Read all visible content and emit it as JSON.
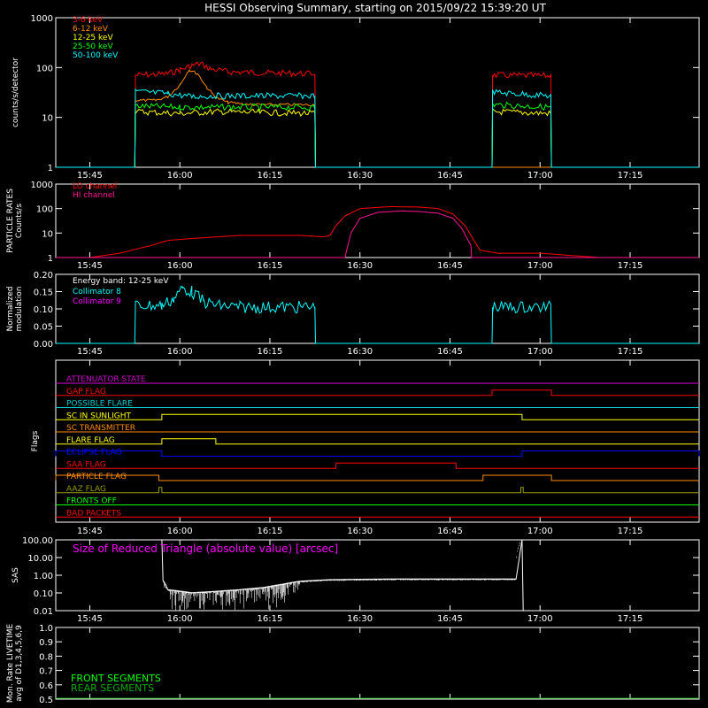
{
  "title": "HESSI Observing Summary, starting on 2015/09/22 15:39:20 UT",
  "time_ticks": [
    "15:45",
    "16:00",
    "16:15",
    "16:30",
    "16:45",
    "17:00",
    "17:15"
  ],
  "time_tick_minutes": [
    45,
    60,
    75,
    90,
    105,
    120,
    135
  ],
  "x_range_minutes": [
    39.33,
    146.5
  ],
  "chart_data": [
    {
      "type": "line",
      "id": "lightcurves",
      "ylabel": "counts/s/detector",
      "yscale": "log",
      "ylim": [
        1,
        1000
      ],
      "yticks": [
        "1",
        "10",
        "100",
        "1000"
      ],
      "yvalues": [
        1,
        10,
        100,
        1000
      ],
      "legend_position": "top-left",
      "series": [
        {
          "name": "3-6 keV",
          "color": "#ff0000",
          "x": [
            39.33,
            52.5,
            52.6,
            58.0,
            60.0,
            62.0,
            63.5,
            65.0,
            68.0,
            75.0,
            82.5,
            82.6,
            112.0,
            112.1,
            121.8,
            121.9,
            146.5
          ],
          "y": [
            1,
            1,
            70,
            75,
            90,
            110,
            120,
            95,
            82,
            78,
            75,
            1,
            1,
            70,
            68,
            1,
            1
          ]
        },
        {
          "name": "6-12 keV",
          "color": "#ff8c00",
          "x": [
            39.33,
            52.5,
            52.6,
            56.0,
            58.0,
            60.0,
            61.5,
            63.0,
            64.5,
            66.0,
            68.0,
            72.0,
            82.5,
            82.6,
            146.5
          ],
          "y": [
            1,
            1,
            22,
            22,
            26,
            45,
            90,
            75,
            40,
            25,
            20,
            18,
            18,
            1,
            1
          ]
        },
        {
          "name": "12-25 keV",
          "color": "#ffff00",
          "x": [
            39.33,
            52.5,
            52.6,
            60.0,
            66.0,
            82.5,
            82.6,
            112.0,
            112.1,
            121.8,
            121.9,
            146.5
          ],
          "y": [
            1,
            1,
            13,
            12,
            13,
            12,
            1,
            1,
            13,
            12,
            1,
            1
          ]
        },
        {
          "name": "25-50 keV",
          "color": "#00ff00",
          "x": [
            39.33,
            52.5,
            52.6,
            60.0,
            82.5,
            82.6,
            112.0,
            112.1,
            121.8,
            121.9,
            146.5
          ],
          "y": [
            1,
            1,
            17,
            16,
            16,
            1,
            1,
            18,
            16,
            1,
            1
          ]
        },
        {
          "name": "50-100 keV",
          "color": "#00ffff",
          "x": [
            39.33,
            52.5,
            52.6,
            58.0,
            62.0,
            66.0,
            82.5,
            82.6,
            112.0,
            112.1,
            121.8,
            121.9,
            146.5
          ],
          "y": [
            1,
            1,
            33,
            30,
            26,
            27,
            27,
            1,
            1,
            32,
            27,
            1,
            1
          ]
        }
      ]
    },
    {
      "type": "line",
      "id": "particle",
      "ylabel": "PARTICLE RATES",
      "ylabel2": "Counts/s",
      "yscale": "log",
      "ylim": [
        1,
        1000
      ],
      "yticks": [
        "1",
        "10",
        "100",
        "1000"
      ],
      "yvalues": [
        1,
        10,
        100,
        1000
      ],
      "legend_position": "top-left",
      "series": [
        {
          "name": "LO channel",
          "color": "#ff0000",
          "x": [
            39.33,
            45.0,
            50.0,
            52.0,
            55.0,
            58.0,
            62.0,
            70.0,
            75.0,
            80.0,
            84.0,
            85.0,
            86.0,
            87.5,
            90.0,
            95.0,
            100.0,
            103.0,
            105.5,
            107.5,
            109.0,
            110.0,
            113.0,
            120.0,
            130.0,
            146.5
          ],
          "y": [
            1,
            1,
            1.5,
            2,
            3,
            5,
            6,
            8,
            8,
            8,
            7,
            8,
            20,
            50,
            100,
            120,
            115,
            100,
            60,
            20,
            5,
            2,
            1.5,
            1.5,
            1,
            1
          ]
        },
        {
          "name": "HI channel",
          "color": "#ff1493",
          "x": [
            39.33,
            87.5,
            88.5,
            90.0,
            93.0,
            97.0,
            100.0,
            103.0,
            105.5,
            107.0,
            108.5,
            108.6,
            146.5
          ],
          "y": [
            1,
            1,
            10,
            40,
            70,
            80,
            75,
            65,
            40,
            15,
            3,
            1,
            1
          ]
        }
      ]
    },
    {
      "type": "line",
      "id": "modulation",
      "ylabel": "Normalized",
      "ylabel2": "modulation",
      "ylim": [
        0.0,
        0.2
      ],
      "yticks": [
        "0.00",
        "0.05",
        "0.10",
        "0.15",
        "0.20"
      ],
      "yvalues": [
        0.0,
        0.05,
        0.1,
        0.15,
        0.2
      ],
      "legend_position": "top-left",
      "legend_header": "Energy band: 12-25 keV",
      "series": [
        {
          "name": "Collimator 8",
          "color": "#00ffff",
          "x": [
            39.33,
            52.5,
            52.6,
            57.0,
            59.0,
            60.5,
            62.0,
            64.0,
            66.0,
            70.0,
            82.5,
            82.6,
            112.0,
            112.1,
            121.8,
            121.9,
            146.5
          ],
          "y": [
            0,
            0,
            0.11,
            0.11,
            0.13,
            0.16,
            0.15,
            0.12,
            0.11,
            0.105,
            0.105,
            0,
            0,
            0.105,
            0.105,
            0,
            0
          ]
        },
        {
          "name": "Collimator 9",
          "color": "#ff00ff",
          "x": [],
          "y": []
        }
      ]
    },
    {
      "type": "line",
      "id": "flags",
      "ylabel": "Flags",
      "flags": [
        {
          "name": "ATTENUATOR STATE",
          "color": "#cc00cc",
          "steps": []
        },
        {
          "name": "GAP FLAG",
          "color": "#ff0000",
          "steps": [
            [
              112.0,
              121.9
            ]
          ]
        },
        {
          "name": "POSSIBLE FLARE",
          "color": "#00cccc",
          "steps": []
        },
        {
          "name": "SC IN SUNLIGHT",
          "color": "#ffff00",
          "steps": [
            [
              57.0,
              117.0
            ]
          ]
        },
        {
          "name": "SC TRANSMITTER",
          "color": "#ff8c00",
          "steps": []
        },
        {
          "name": "FLARE FLAG",
          "color": "#ffff00",
          "steps": [
            [
              57.0,
              66.0
            ]
          ]
        },
        {
          "name": "ECLIPSE FLAG",
          "color": "#0000ff",
          "steps": [
            [
              39.33,
              57.0
            ],
            [
              117.0,
              146.5
            ]
          ]
        },
        {
          "name": "SAA FLAG",
          "color": "#ff0000",
          "steps": [
            [
              86.0,
              106.0
            ]
          ]
        },
        {
          "name": "PARTICLE FLAG",
          "color": "#ff8c00",
          "steps": [
            [
              39.33,
              56.5
            ],
            [
              110.5,
              121.9
            ]
          ]
        },
        {
          "name": "AAZ FLAG",
          "color": "#999900",
          "steps": [
            [
              56.5,
              57.0
            ],
            [
              116.8,
              117.2
            ]
          ]
        },
        {
          "name": "FRONTS OFF",
          "color": "#00ff00",
          "steps": []
        },
        {
          "name": "BAD PACKETS",
          "color": "#ff0000",
          "steps": []
        }
      ]
    },
    {
      "type": "line",
      "id": "sas",
      "ylabel": "SAS",
      "yscale": "log",
      "ylim": [
        0.01,
        100
      ],
      "yticks": [
        "0.01",
        "0.10",
        "1.00",
        "10.00",
        "100.00"
      ],
      "yvalues": [
        0.01,
        0.1,
        1,
        10,
        100
      ],
      "annotation": "Size of Reduced Triangle (absolute value) [arcsec]",
      "series": [
        {
          "name": "",
          "color": "#ffffff",
          "x": [
            57.0,
            57.2,
            58.0,
            62.0,
            66.0,
            70.0,
            74.0,
            77.0,
            80.0,
            85.0,
            95.0,
            105.0,
            116.0,
            117.0,
            117.2
          ],
          "y": [
            100,
            0.5,
            0.15,
            0.1,
            0.12,
            0.15,
            0.2,
            0.3,
            0.45,
            0.55,
            0.6,
            0.6,
            0.6,
            100,
            0.01
          ]
        }
      ]
    },
    {
      "type": "line",
      "id": "livetime",
      "ylabel": "Mon. Rate LIVETIME",
      "ylabel2": "avg of D1,3,4,5,6,9",
      "ylim": [
        0.5,
        1.0
      ],
      "yticks": [
        "0.5",
        "0.6",
        "0.7",
        "0.8",
        "0.9",
        "1.0"
      ],
      "yvalues": [
        0.5,
        0.6,
        0.7,
        0.8,
        0.9,
        1.0
      ],
      "legend_position": "bottom-left",
      "series": [
        {
          "name": "FRONT SEGMENTS",
          "color": "#00ff00",
          "x": [],
          "y": []
        },
        {
          "name": "REAR SEGMENTS",
          "color": "#00aa00",
          "x": [],
          "y": []
        }
      ]
    }
  ]
}
